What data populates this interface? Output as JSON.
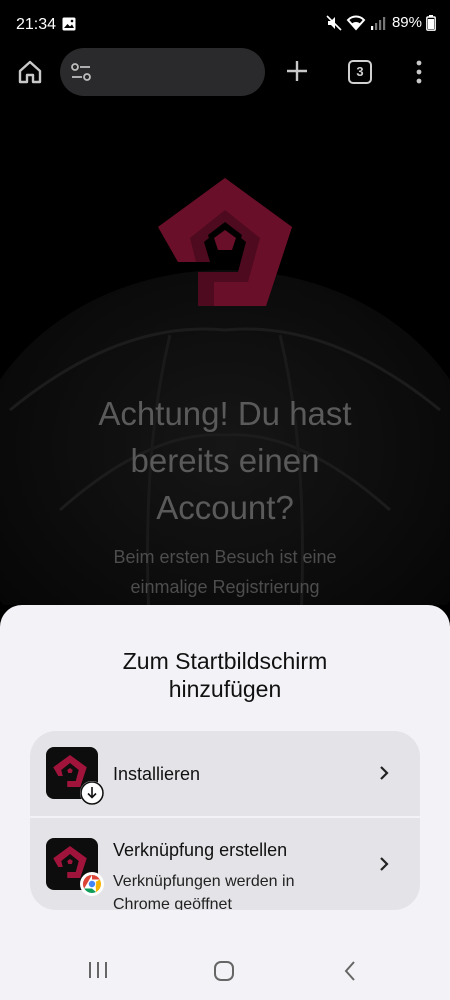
{
  "status_bar": {
    "time": "21:34",
    "battery": "89%",
    "icons": [
      "gallery-icon",
      "mute-icon",
      "wifi-icon",
      "signal-icon",
      "battery-icon"
    ]
  },
  "toolbar": {
    "tab_count": "3",
    "icons": [
      "home-icon",
      "tune-icon",
      "add-icon",
      "more-vert-icon"
    ]
  },
  "page": {
    "headline_1": "Achtung! Du hast",
    "headline_2": "bereits einen",
    "headline_3": "Account?",
    "subtext_1": "Beim ersten Besuch ist eine",
    "subtext_2": "einmalige Registrierung"
  },
  "sheet": {
    "title_1": "Zum Startbildschirm",
    "title_2": "hinzufügen",
    "install": {
      "label": "Installieren"
    },
    "shortcut": {
      "label": "Verknüpfung erstellen",
      "desc_1": "Verknüpfungen werden in",
      "desc_2": "Chrome geöffnet"
    }
  },
  "colors": {
    "brand": "#a0143c",
    "sheet_bg": "#f3f3f7",
    "option_bg": "#e4e4e8"
  }
}
